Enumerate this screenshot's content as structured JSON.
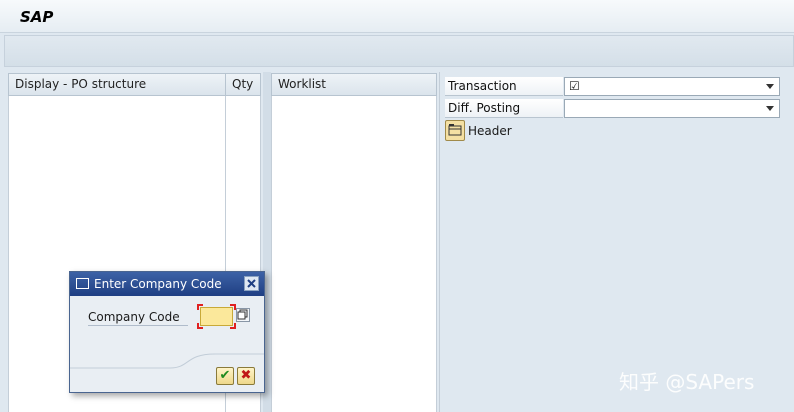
{
  "app": {
    "title": "SAP"
  },
  "left_panel": {
    "col1": "Display - PO structure",
    "col2": "Qty"
  },
  "worklist": {
    "title": "Worklist"
  },
  "form": {
    "transaction_label": "Transaction",
    "transaction_value": "☑",
    "diff_posting_label": "Diff. Posting",
    "diff_posting_value": "",
    "header_label": "Header"
  },
  "dialog": {
    "title": "Enter Company Code",
    "field_label": "Company Code",
    "field_value": "",
    "ok_label": "✔",
    "cancel_label": "✖"
  },
  "watermark": "知乎 @SAPers"
}
